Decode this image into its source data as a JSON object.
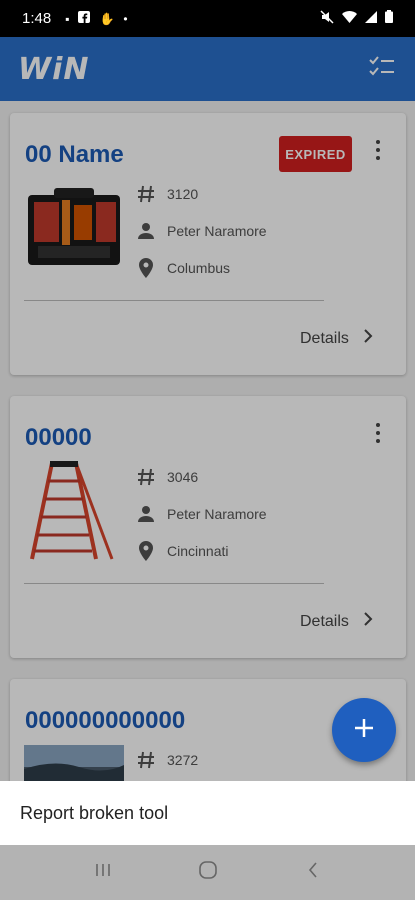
{
  "status_bar": {
    "time": "1:48",
    "left_icons": [
      "signal-indicator-icon",
      "facebook-icon",
      "hand-icon",
      "dot-icon"
    ],
    "right_icons": [
      "mute-icon",
      "wifi-icon",
      "cell-signal-icon",
      "battery-icon"
    ]
  },
  "app_bar": {
    "logo": "WiN",
    "action_icon": "checklist-icon"
  },
  "cards": [
    {
      "title": "00 Name",
      "badge": "EXPIRED",
      "badge_color": "#d11f1f",
      "number": "3120",
      "owner": "Peter Naramore",
      "location": "Columbus",
      "details_label": "Details",
      "image": "tool-bag-image"
    },
    {
      "title": "00000",
      "badge": "",
      "number": "3046",
      "owner": "Peter Naramore",
      "location": "Cincinnati",
      "details_label": "Details",
      "image": "ladder-image"
    },
    {
      "title": "000000000000",
      "badge": "",
      "number": "3272",
      "image": "landscape-photo-image"
    }
  ],
  "fab": {
    "icon": "plus-icon"
  },
  "bottom_sheet": {
    "items": [
      "Report broken tool"
    ]
  },
  "colors": {
    "brand_blue": "#2a6fc9",
    "title_blue": "#1c5bb5",
    "fab_blue": "#1f5fbf"
  }
}
